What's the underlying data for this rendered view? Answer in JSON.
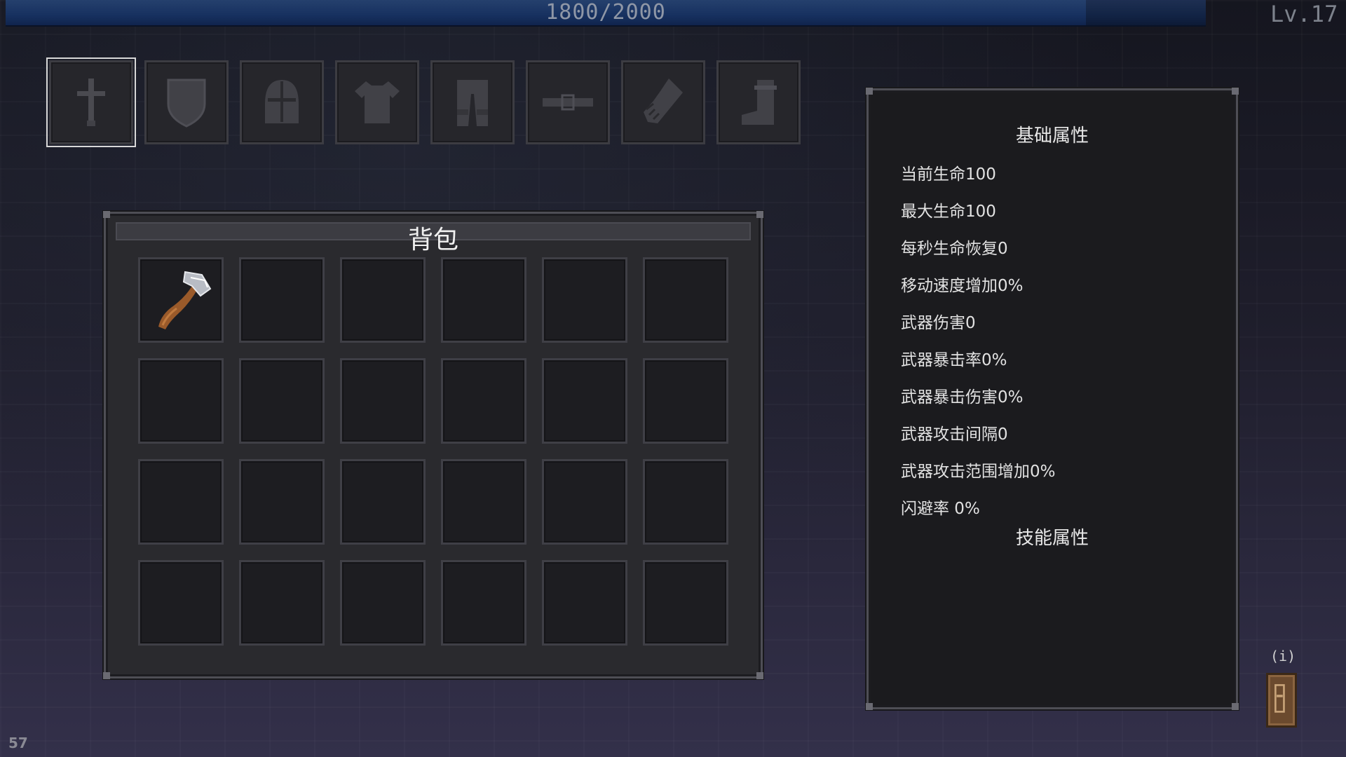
{
  "hud": {
    "xp_text": "1800/2000",
    "xp_fraction": 0.9,
    "level_text": "Lv.17"
  },
  "equipment": {
    "slots": [
      {
        "name": "weapon",
        "icon": "sword-icon",
        "selected": true
      },
      {
        "name": "shield",
        "icon": "shield-icon",
        "selected": false
      },
      {
        "name": "helmet",
        "icon": "helmet-icon",
        "selected": false
      },
      {
        "name": "armor",
        "icon": "chest-armor-icon",
        "selected": false
      },
      {
        "name": "pants",
        "icon": "pants-icon",
        "selected": false
      },
      {
        "name": "belt",
        "icon": "belt-icon",
        "selected": false
      },
      {
        "name": "gloves",
        "icon": "glove-icon",
        "selected": false
      },
      {
        "name": "boots",
        "icon": "boot-icon",
        "selected": false
      }
    ]
  },
  "bag": {
    "title": "背包",
    "rows": 4,
    "cols": 6,
    "items": [
      {
        "slot": 0,
        "icon": "axe-icon"
      }
    ]
  },
  "stats": {
    "basic_title": "基础属性",
    "skill_title": "技能属性",
    "lines": [
      "当前生命100",
      "最大生命100",
      "每秒生命恢复0",
      "移动速度增加0%",
      "武器伤害0",
      "武器暴击率0%",
      "武器暴击伤害0%",
      "武器攻击间隔0",
      "武器攻击范围增加0%",
      "闪避率 0%"
    ]
  },
  "info": {
    "label": "(i)",
    "icon": "info-book-icon"
  },
  "fps": "57",
  "colors": {
    "xp_bar": "#173160",
    "panel_bg": "#2a2a2e",
    "slot_bg": "#1d1d21",
    "accent_wood": "#6b4a2e"
  }
}
